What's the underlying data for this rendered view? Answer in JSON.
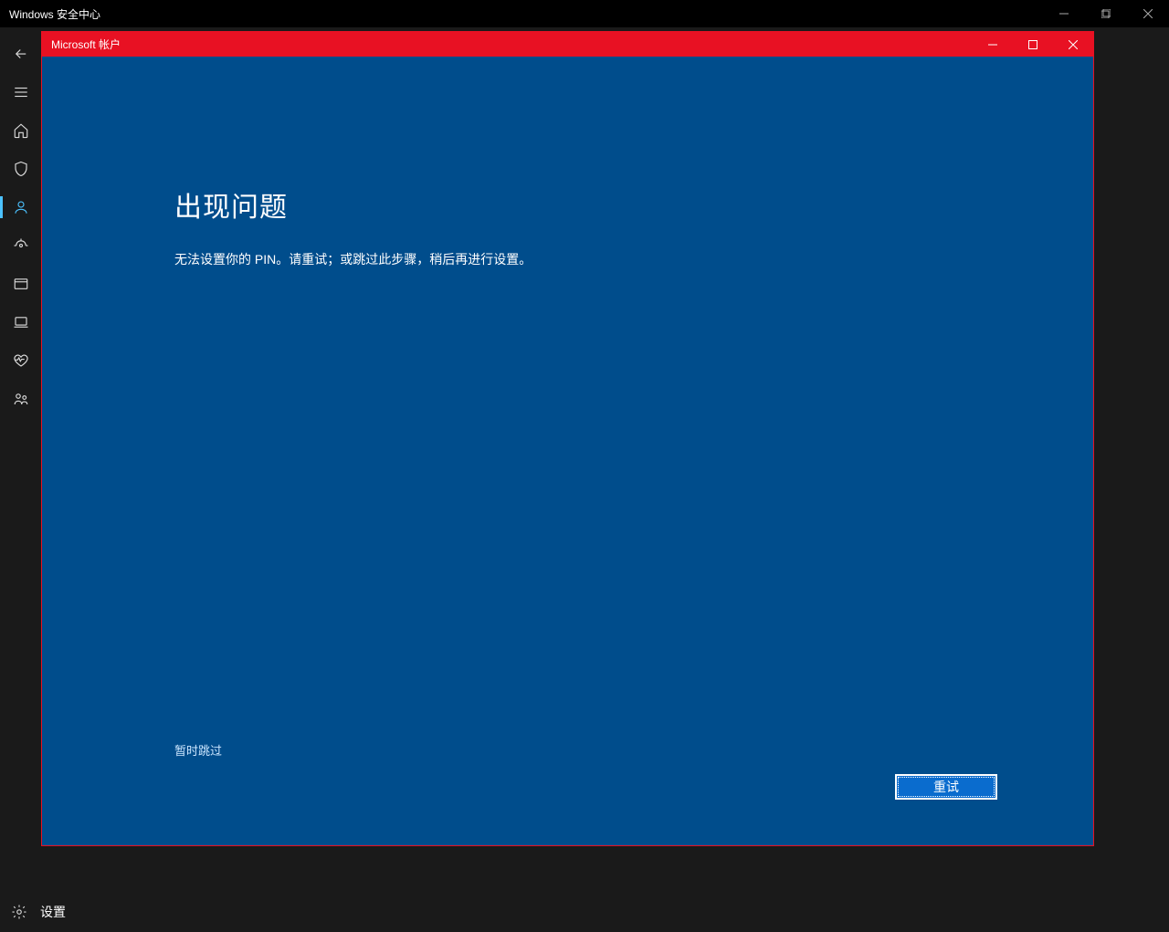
{
  "outer_window": {
    "title": "Windows 安全中心"
  },
  "sidebar": {
    "settings_label": "设置"
  },
  "dialog": {
    "title": "Microsoft 帐户",
    "heading": "出现问题",
    "message": "无法设置你的 PIN。请重试；或跳过此步骤，稍后再进行设置。",
    "skip_label": "暂时跳过",
    "retry_label": "重试"
  }
}
